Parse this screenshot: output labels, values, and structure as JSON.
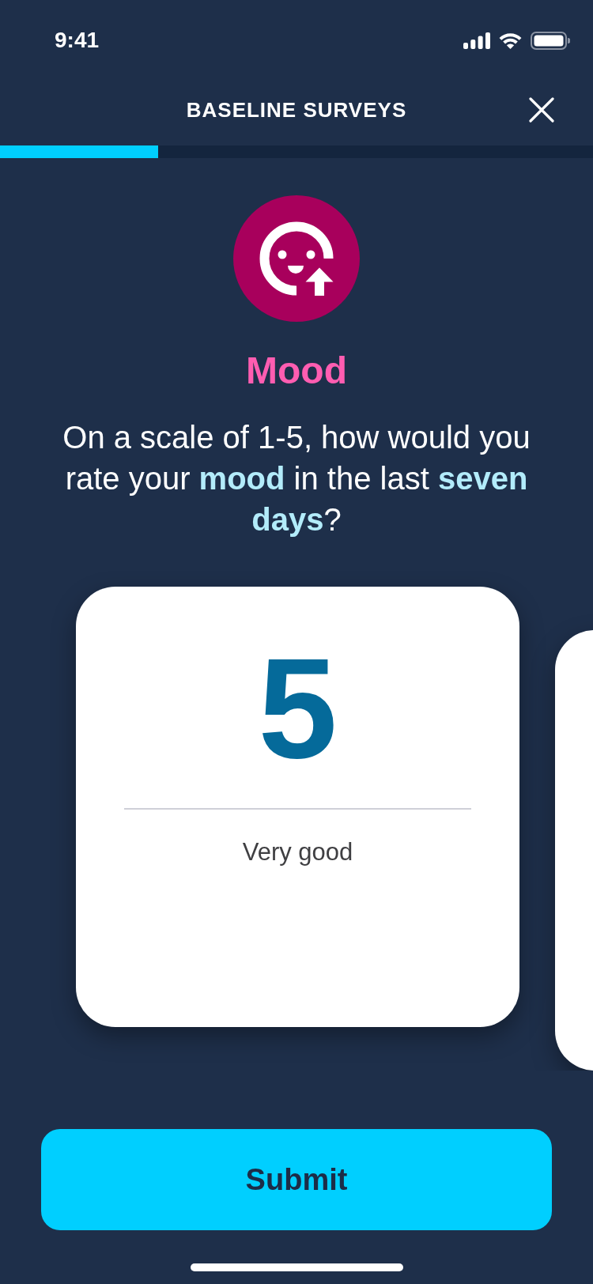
{
  "status_bar": {
    "time": "9:41"
  },
  "header": {
    "title": "BASELINE SURVEYS"
  },
  "progress": {
    "level": 0.267
  },
  "category": {
    "title": "Mood"
  },
  "question": {
    "text": "On a scale of 1-5, how would you rate your **mood** in the last **seven days**?"
  },
  "options": [
    {
      "number": "5",
      "label": "Very good",
      "selected": true
    },
    {
      "selected": false
    }
  ],
  "submit_button": {
    "label": "Submit"
  }
}
